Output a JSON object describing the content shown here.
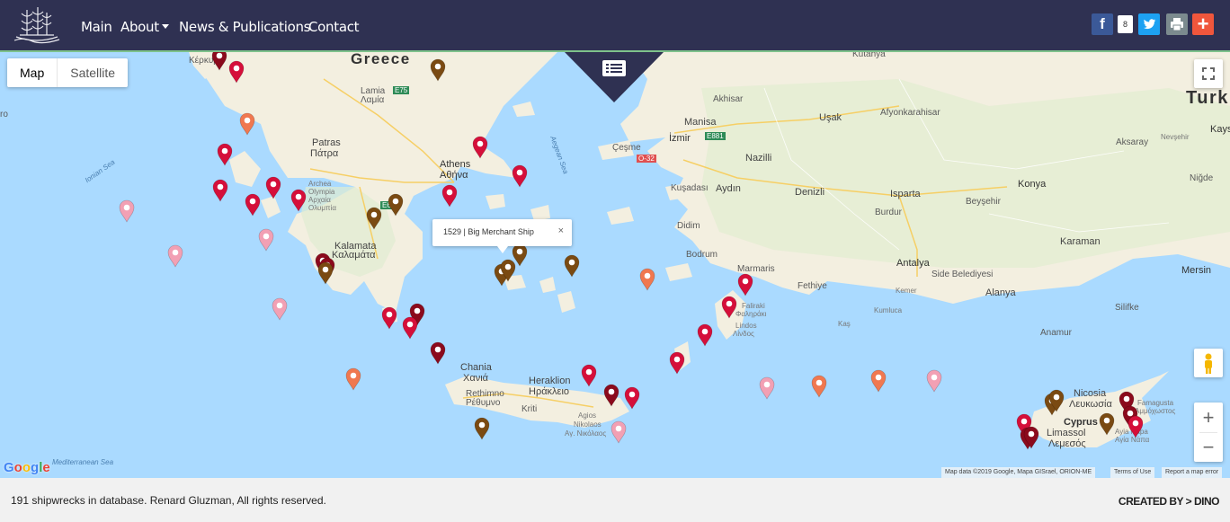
{
  "nav": {
    "links": [
      "Main",
      "About",
      "News & Publications",
      "Contact"
    ],
    "share_count": "8",
    "share_icons": [
      "facebook-icon",
      "twitter-icon",
      "print-icon",
      "plus-icon"
    ]
  },
  "map": {
    "map_types": [
      "Map",
      "Satellite"
    ],
    "selected_map_type": "Map",
    "zoom_in": "+",
    "zoom_out": "−",
    "infowindow": {
      "text": "1529 | Big Merchant Ship",
      "close": "×"
    },
    "google_logo": "Google",
    "attribution": "Map data ©2019 Google, Mapa GISrael, ORION-ME",
    "terms": "Terms of Use",
    "report": "Report a map error",
    "labels": {
      "greece": "Greece",
      "turkey": "Turk",
      "kerkyra": "Κέρκυρα",
      "lamia": "Lamia",
      "lamia_gr": "Λαμία",
      "patras": "Patras",
      "patras_gr": "Πάτρα",
      "archea": "Archea",
      "olympia": "Olympia",
      "olympia_gr": "Αρχαία",
      "olympia_gr2": "Ολυμπία",
      "kalamata": "Kalamata",
      "kalamata_gr": "Καλαμάτα",
      "athens": "Athens",
      "athens_gr": "Αθήνα",
      "chania": "Chania",
      "chania_gr": "Χανιά",
      "rethimno": "Rethimno",
      "rethimno_gr": "Ρέθυμνο",
      "heraklion": "Heraklion",
      "heraklion_gr": "Ηράκλειο",
      "kriti": "Kriti",
      "agios": "Agios",
      "agios2": "Nikolaos",
      "agios_gr": "Αγ. Νικόλαος",
      "izmir": "İzmir",
      "manisa": "Manisa",
      "akhisar": "Akhisar",
      "usak": "Uşak",
      "kutahya": "Kütahya",
      "afyon": "Afyonkarahisar",
      "aksaray": "Aksaray",
      "nevsehir": "Nevşehir",
      "kays": "Kays",
      "cesme": "Çeşme",
      "kusadasi": "Kuşadası",
      "aydin": "Aydın",
      "nazilli": "Nazilli",
      "denizli": "Denizli",
      "isparta": "Isparta",
      "burdur": "Burdur",
      "beysehir": "Beyşehir",
      "konya": "Konya",
      "nigde": "Niğde",
      "karaman": "Karaman",
      "didim": "Didim",
      "bodrum": "Bodrum",
      "marmaris": "Marmaris",
      "fethiye": "Fethiye",
      "antalya": "Antalya",
      "side": "Side Belediyesi",
      "alanya": "Alanya",
      "mersin": "Mersin",
      "silifke": "Silifke",
      "anamur": "Anamur",
      "kemer": "Kemer",
      "kumluca": "Kumluca",
      "kas": "Kaş",
      "faliraki": "Faliraki",
      "faliraki_gr": "Φαληράκι",
      "lindos": "Lindos",
      "lindos_gr": "Λίνδος",
      "nicosia": "Nicosia",
      "nicosia_gr": "Λευκωσία",
      "cyprus": "Cyprus",
      "limassol": "Limassol",
      "limassol_gr": "Λεμεσός",
      "famagusta": "Famagusta",
      "famagusta_gr": "Αμμόχωστος",
      "ayia": "Ayia Napa",
      "ayia_gr": "Αγία Νάπα",
      "ionian": "Ionian Sea",
      "aegean": "Aegean Sea",
      "med": "Mediterranean Sea",
      "e75": "E75",
      "e65": "E65",
      "e881": "E881",
      "o32": "O-32",
      "ro": "ro"
    },
    "marker_colors": {
      "red": "#d50f3a",
      "darkred": "#8b0a1c",
      "brown": "#7a4a12",
      "orange": "#f07850",
      "pink": "#f2a0b4"
    }
  },
  "footer": {
    "text": "191 shipwrecks in database. Renard Gluzman, All rights reserved.",
    "credit": "CREATED BY > DINO"
  }
}
